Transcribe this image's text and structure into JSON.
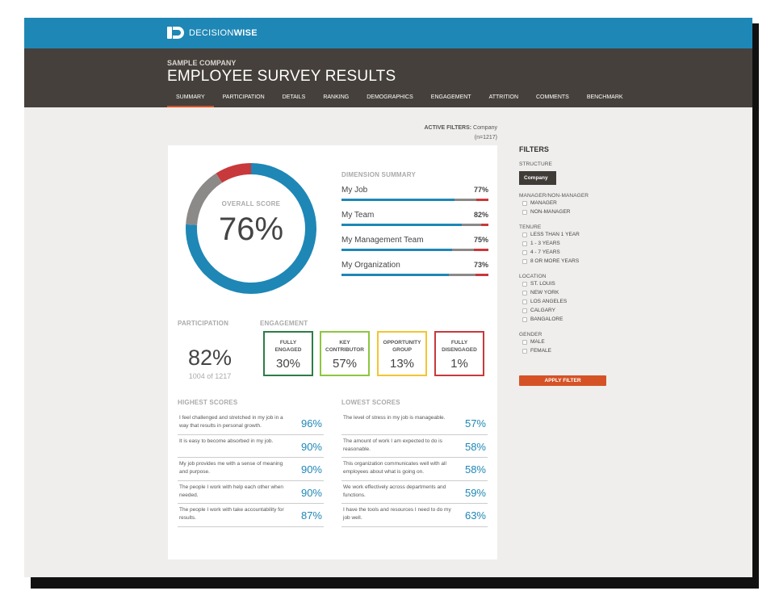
{
  "brand": {
    "logo_text_light": "DECISION",
    "logo_text_bold": "WISE"
  },
  "header": {
    "company": "SAMPLE COMPANY",
    "title": "EMPLOYEE SURVEY RESULTS",
    "tabs": [
      {
        "label": "SUMMARY",
        "active": true
      },
      {
        "label": "PARTICIPATION"
      },
      {
        "label": "DETAILS"
      },
      {
        "label": "RANKING"
      },
      {
        "label": "DEMOGRAPHICS"
      },
      {
        "label": "ENGAGEMENT"
      },
      {
        "label": "ATTRITION"
      },
      {
        "label": "COMMENTS"
      },
      {
        "label": "BENCHMARK"
      }
    ]
  },
  "active_filters": {
    "label": "ACTIVE FILTERS:",
    "value": "Company",
    "count": "(n=1217)"
  },
  "overall": {
    "label": "OVERALL SCORE",
    "value": "76%",
    "segments": {
      "favorable": 0.76,
      "neutral": 0.15,
      "unfavorable": 0.09
    }
  },
  "dimension_summary": {
    "title": "DIMENSION SUMMARY",
    "items": [
      {
        "label": "My Job",
        "pct": "77%",
        "fav": 0.77,
        "neu": 0.15,
        "unf": 0.08
      },
      {
        "label": "My Team",
        "pct": "82%",
        "fav": 0.82,
        "neu": 0.13,
        "unf": 0.05
      },
      {
        "label": "My Management Team",
        "pct": "75%",
        "fav": 0.75,
        "neu": 0.15,
        "unf": 0.1
      },
      {
        "label": "My Organization",
        "pct": "73%",
        "fav": 0.73,
        "neu": 0.18,
        "unf": 0.09
      }
    ]
  },
  "participation": {
    "title": "PARTICIPATION",
    "value": "82%",
    "sub": "1004 of 1217"
  },
  "engagement": {
    "title": "ENGAGEMENT",
    "boxes": [
      {
        "label": "FULLY ENGAGED",
        "value": "30%",
        "color": "#2e7d46"
      },
      {
        "label": "KEY CONTRIBUTOR",
        "value": "57%",
        "color": "#8dc63f"
      },
      {
        "label": "OPPORTUNITY GROUP",
        "value": "13%",
        "color": "#f3c531"
      },
      {
        "label": "FULLY DISENGAGED",
        "value": "1%",
        "color": "#c8393b"
      }
    ]
  },
  "highest_scores": {
    "title": "HIGHEST SCORES",
    "items": [
      {
        "text": "I feel challenged and stretched in my job in a way that results in personal growth.",
        "value": "96%"
      },
      {
        "text": "It is easy to become absorbed in my job.",
        "value": "90%"
      },
      {
        "text": "My job provides me with a sense of meaning and purpose.",
        "value": "90%"
      },
      {
        "text": "The people I work with help each other when needed.",
        "value": "90%"
      },
      {
        "text": "The people I work with take accountability for results.",
        "value": "87%"
      }
    ]
  },
  "lowest_scores": {
    "title": "LOWEST SCORES",
    "items": [
      {
        "text": "The level of stress in my job is manageable.",
        "value": "57%"
      },
      {
        "text": "The amount of work I am expected to do is reasonable.",
        "value": "58%"
      },
      {
        "text": "This organization communicates well with all employees about what is going on.",
        "value": "58%"
      },
      {
        "text": "We work effectively across departments and functions.",
        "value": "59%"
      },
      {
        "text": "I have the tools and resources I need to do my job well.",
        "value": "63%"
      }
    ]
  },
  "filters": {
    "title": "FILTERS",
    "structure": {
      "title": "STRUCTURE",
      "selected": "Company"
    },
    "groups": [
      {
        "title": "MANAGER/NON-MANAGER",
        "options": [
          "MANAGER",
          "NON-MANAGER"
        ]
      },
      {
        "title": "TENURE",
        "options": [
          "LESS THAN 1 YEAR",
          "1 - 3 YEARS",
          "4 - 7 YEARS",
          "8 OR MORE YEARS"
        ]
      },
      {
        "title": "LOCATION",
        "options": [
          "ST. LOUIS",
          "NEW YORK",
          "LOS ANGELES",
          "CALGARY",
          "BANGALORE"
        ]
      },
      {
        "title": "GENDER",
        "options": [
          "MALE",
          "FEMALE"
        ]
      }
    ],
    "apply_label": "APPLY FILTER"
  },
  "colors": {
    "favorable": "#1e87b6",
    "neutral": "#8c8a88",
    "unfavorable": "#c8393b",
    "accent": "#d55226",
    "header_dark": "#45403b"
  }
}
